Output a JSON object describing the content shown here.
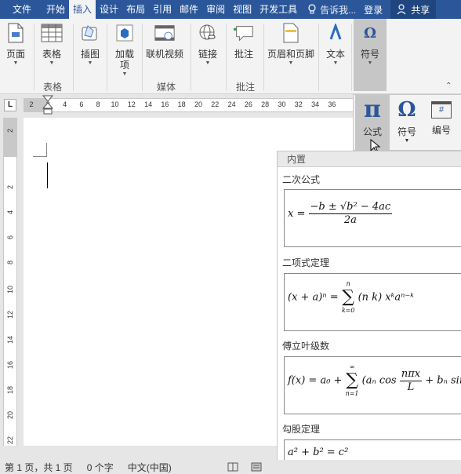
{
  "tabs": [
    "文件",
    "开始",
    "插入",
    "设计",
    "布局",
    "引用",
    "邮件",
    "审阅",
    "视图",
    "开发工具"
  ],
  "active_tab": "插入",
  "tell_me": "告诉我...",
  "login": "登录",
  "share": "共享",
  "ribbon": {
    "page": "页面",
    "table": "表格",
    "illustrations": "插图",
    "addins": "加载项",
    "online_video": "联机视频",
    "link": "链接",
    "comment": "批注",
    "header_footer": "页眉和页脚",
    "text": "文本",
    "symbols": "符号",
    "groups": {
      "table": "表格",
      "media": "媒体",
      "comments": "批注"
    }
  },
  "symbols_dropdown": {
    "equation": "公式",
    "symbol": "符号",
    "number": "编号",
    "equation_glyph": "π",
    "symbol_glyph": "Ω",
    "number_glyph": "#"
  },
  "ruler": {
    "corner": "L",
    "h_ticks": [
      "2",
      "2",
      "4",
      "6",
      "8",
      "10",
      "12",
      "14",
      "16",
      "18",
      "20",
      "22",
      "24",
      "26",
      "28",
      "30",
      "32",
      "34",
      "36"
    ],
    "v_ticks": [
      "2",
      "2",
      "4",
      "6",
      "8",
      "10",
      "12",
      "14",
      "16",
      "18",
      "20",
      "22"
    ]
  },
  "gallery": {
    "header": "内置",
    "items": [
      {
        "title": "二次公式"
      },
      {
        "title": "二项式定理"
      },
      {
        "title": "傅立叶级数"
      },
      {
        "title": "勾股定理"
      }
    ],
    "eq": {
      "quadratic_lhs": "x =",
      "quadratic_num": "−b ± √b² − 4ac",
      "quadratic_den": "2a",
      "binomial_lhs": "(x + a)ⁿ =",
      "binomial_upper": "n",
      "binomial_lower": "k=0",
      "binomial_rhs": "(n k) xᵏaⁿ⁻ᵏ",
      "fourier_lhs": "f(x) = a₀ +",
      "fourier_upper": "∞",
      "fourier_lower": "n=1",
      "fourier_rhs_a": "(aₙ cos",
      "fourier_frac_num": "nπx",
      "fourier_frac_den": "L",
      "fourier_rhs_b": "+ bₙ sin",
      "pythag": "a² + b² = c²"
    }
  },
  "status": {
    "page": "第 1 页，共 1 页",
    "words": "0 个字",
    "language": "中文(中国)"
  }
}
